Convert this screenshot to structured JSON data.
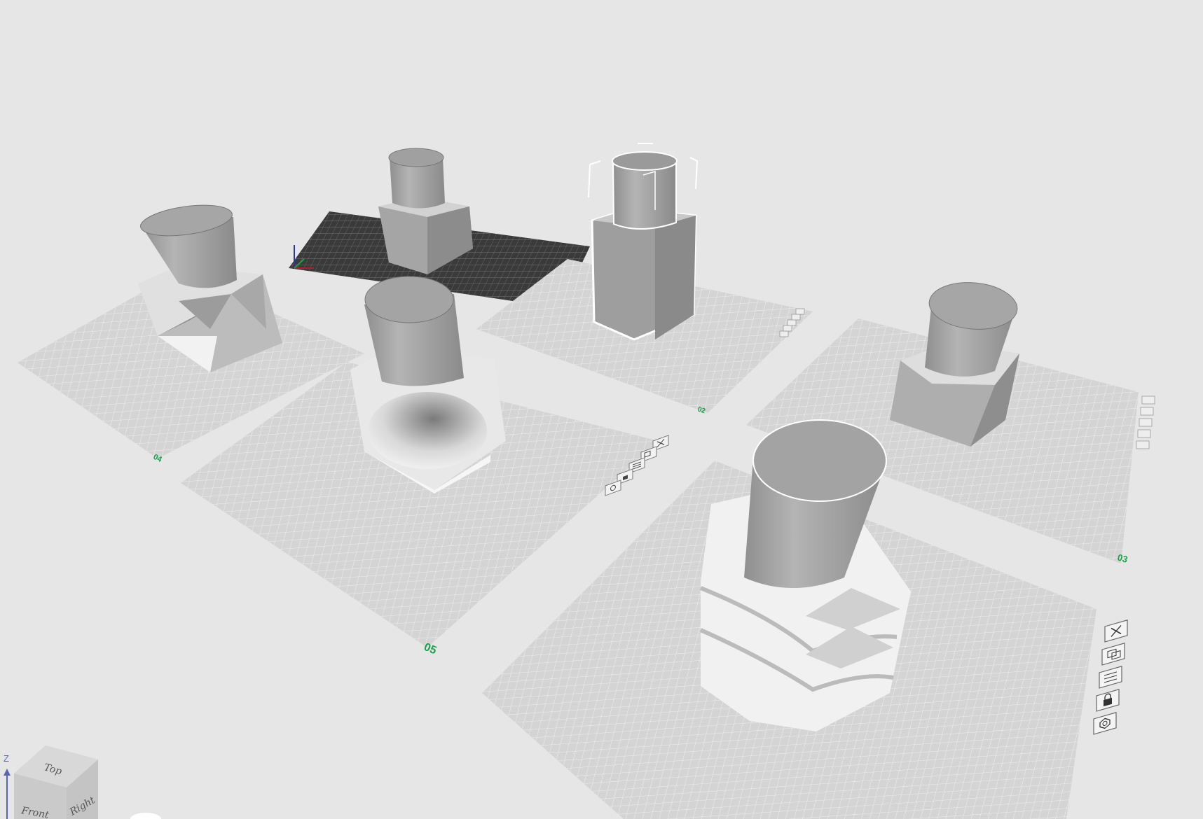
{
  "app": {
    "view": "3D build plates"
  },
  "plates": [
    {
      "id": "p04",
      "label": "04",
      "selected": false
    },
    {
      "id": "p05",
      "label": "05",
      "selected": false
    },
    {
      "id": "p02",
      "label": "02",
      "selected": false
    },
    {
      "id": "p03",
      "label": "03",
      "selected": false
    },
    {
      "id": "pactive",
      "label": "",
      "selected": true
    }
  ],
  "plate_toolbar_icons": [
    "close-icon",
    "arrange-icon",
    "layers-icon",
    "lock-icon",
    "settings-icon"
  ],
  "nav_cube": {
    "faces": {
      "top": "Top",
      "front": "Front",
      "right": "Right"
    },
    "axis_label": "Z"
  },
  "colors": {
    "background": "#e6e6e6",
    "plate": "#d4d4d4",
    "plate_grid": "#f2f2f2",
    "label_green": "#1aa04a",
    "model_grey": "#9a9a9a",
    "selection_outline": "#ffffff"
  }
}
